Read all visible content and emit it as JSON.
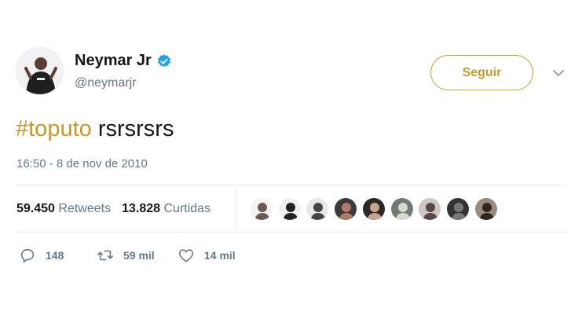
{
  "author": {
    "name": "Neymar Jr",
    "handle": "@neymarjr",
    "verified_color": "#1da1f2"
  },
  "follow_button": {
    "label": "Seguir",
    "color": "#c49a2a"
  },
  "tweet": {
    "hashtag": "#toputo",
    "text": " rsrsrsrs",
    "timestamp": "16:50 - 8 de nov de 2010"
  },
  "stats": {
    "retweets_count": "59.450",
    "retweets_label": "Retweets",
    "likes_count": "13.828",
    "likes_label": "Curtidas"
  },
  "liker_avatars": [
    {
      "name": "liker-avatar-1",
      "bg": "#f4f4f4",
      "fg": "#6b5a55"
    },
    {
      "name": "liker-avatar-2",
      "bg": "#f1f1f1",
      "fg": "#222222"
    },
    {
      "name": "liker-avatar-3",
      "bg": "#e8e8e8",
      "fg": "#444444"
    },
    {
      "name": "liker-avatar-4",
      "bg": "#3a3a3a",
      "fg": "#b07a6a"
    },
    {
      "name": "liker-avatar-5",
      "bg": "#2a2a2a",
      "fg": "#c9a58a"
    },
    {
      "name": "liker-avatar-6",
      "bg": "#6f7a72",
      "fg": "#d8d8d0"
    },
    {
      "name": "liker-avatar-7",
      "bg": "#cfc7c4",
      "fg": "#5a4844"
    },
    {
      "name": "liker-avatar-8",
      "bg": "#333333",
      "fg": "#777777"
    },
    {
      "name": "liker-avatar-9",
      "bg": "#9a8b7b",
      "fg": "#2e2620"
    }
  ],
  "actions": {
    "replies": "148",
    "retweets": "59 mil",
    "likes": "14 mil"
  },
  "icons": [
    "avatar",
    "verified-badge-icon",
    "chevron-down-icon",
    "reply-icon",
    "retweet-icon",
    "like-icon"
  ]
}
